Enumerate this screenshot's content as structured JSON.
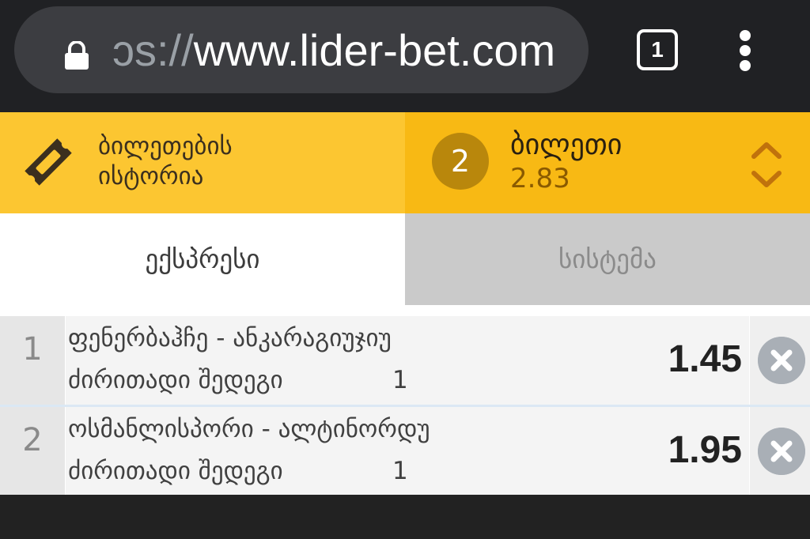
{
  "browser": {
    "url_scheme": "ɔs://",
    "url_host": "www.lider-bet.com",
    "tab_count": "1",
    "icons": {
      "lock": "lock-icon",
      "menu": "more-vert-icon"
    }
  },
  "header": {
    "history_label_line1": "ბილეთების",
    "history_label_line2": "ისტორია",
    "ticket_count": "2",
    "ticket_title": "ბილეთი",
    "ticket_total_odds": "2.83",
    "colors": {
      "history_bg": "#fcc631",
      "slip_bg": "#f8b914",
      "badge": "#b9870c"
    }
  },
  "tabs": {
    "express": "ექსპრესი",
    "system": "სისტემა",
    "active": "express"
  },
  "bets": [
    {
      "index": "1",
      "match": "ფენერბაჰჩე - ანკარაგიუჯიუ",
      "market": "ძირითადი შედეგი",
      "pick": "1",
      "odds": "1.45"
    },
    {
      "index": "2",
      "match": "ოსმანლისპორი - ალტინორდუ",
      "market": "ძირითადი შედეგი",
      "pick": "1",
      "odds": "1.95"
    }
  ]
}
